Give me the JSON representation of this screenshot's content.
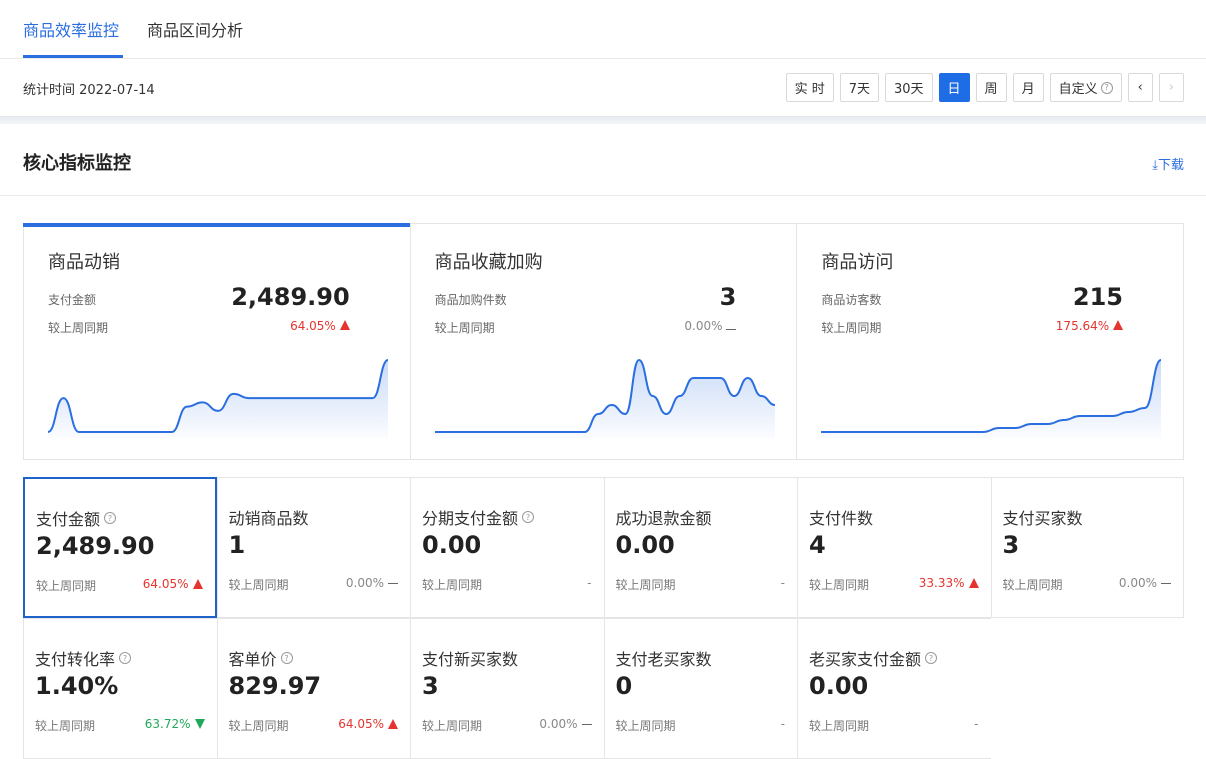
{
  "tabs": [
    {
      "label": "商品效率监控",
      "active": true
    },
    {
      "label": "商品区间分析",
      "active": false
    }
  ],
  "stat_time": "统计时间 2022-07-14",
  "periods": [
    {
      "label": "实 时",
      "active": false
    },
    {
      "label": "7天",
      "active": false
    },
    {
      "label": "30天",
      "active": false
    },
    {
      "label": "日",
      "active": true
    },
    {
      "label": "周",
      "active": false
    },
    {
      "label": "月",
      "active": false
    },
    {
      "label": "自定义",
      "active": false
    }
  ],
  "section": {
    "title": "核心指标监控",
    "download": "下载"
  },
  "big_cards": [
    {
      "title": "商品动销",
      "label": "支付金额",
      "value": "2,489.90",
      "cmp_label": "较上周同期",
      "cmp_value": "64.05%",
      "trend": "up",
      "series": [
        0,
        8,
        0,
        0,
        0,
        0,
        0,
        0,
        0,
        6,
        7,
        5,
        9,
        8,
        8,
        8,
        8,
        8,
        8,
        8,
        8,
        8,
        17
      ]
    },
    {
      "title": "商品收藏加购",
      "label": "商品加购件数",
      "value": "3",
      "cmp_label": "较上周同期",
      "cmp_value": "0.00%",
      "trend": "flat",
      "series": [
        0,
        0,
        0,
        0,
        0,
        0,
        0,
        0,
        0,
        0,
        0,
        0,
        1,
        1.5,
        1,
        4,
        2,
        1,
        2,
        3,
        3,
        3,
        2,
        3,
        2,
        1.5
      ]
    },
    {
      "title": "商品访问",
      "label": "商品访客数",
      "value": "215",
      "cmp_label": "较上周同期",
      "cmp_value": "175.64%",
      "trend": "up",
      "series": [
        0,
        0,
        0,
        0,
        0,
        0,
        0,
        0,
        0,
        0,
        0,
        1,
        1,
        2,
        2,
        3,
        4,
        4,
        4,
        5,
        6,
        18
      ]
    }
  ],
  "metrics_row1": [
    {
      "label": "支付金额",
      "help": true,
      "value": "2,489.90",
      "cmp_label": "较上周同期",
      "cmp_value": "64.05%",
      "trend": "up"
    },
    {
      "label": "动销商品数",
      "help": false,
      "value": "1",
      "cmp_label": "较上周同期",
      "cmp_value": "0.00%",
      "trend": "flat"
    },
    {
      "label": "分期支付金额",
      "help": true,
      "value": "0.00",
      "cmp_label": "较上周同期",
      "cmp_value": "-",
      "trend": "none"
    },
    {
      "label": "成功退款金额",
      "help": false,
      "value": "0.00",
      "cmp_label": "较上周同期",
      "cmp_value": "-",
      "trend": "none"
    },
    {
      "label": "支付件数",
      "help": false,
      "value": "4",
      "cmp_label": "较上周同期",
      "cmp_value": "33.33%",
      "trend": "up"
    },
    {
      "label": "支付买家数",
      "help": false,
      "value": "3",
      "cmp_label": "较上周同期",
      "cmp_value": "0.00%",
      "trend": "flat"
    }
  ],
  "metrics_row2": [
    {
      "label": "支付转化率",
      "help": true,
      "value": "1.40%",
      "cmp_label": "较上周同期",
      "cmp_value": "63.72%",
      "trend": "down"
    },
    {
      "label": "客单价",
      "help": true,
      "value": "829.97",
      "cmp_label": "较上周同期",
      "cmp_value": "64.05%",
      "trend": "up"
    },
    {
      "label": "支付新买家数",
      "help": false,
      "value": "3",
      "cmp_label": "较上周同期",
      "cmp_value": "0.00%",
      "trend": "flat"
    },
    {
      "label": "支付老买家数",
      "help": false,
      "value": "0",
      "cmp_label": "较上周同期",
      "cmp_value": "-",
      "trend": "none"
    },
    {
      "label": "老买家支付金额",
      "help": true,
      "value": "0.00",
      "cmp_label": "较上周同期",
      "cmp_value": "-",
      "trend": "none"
    }
  ],
  "colors": {
    "accent": "#2a6ee0",
    "up": "#e5342d",
    "down": "#21a75a"
  }
}
